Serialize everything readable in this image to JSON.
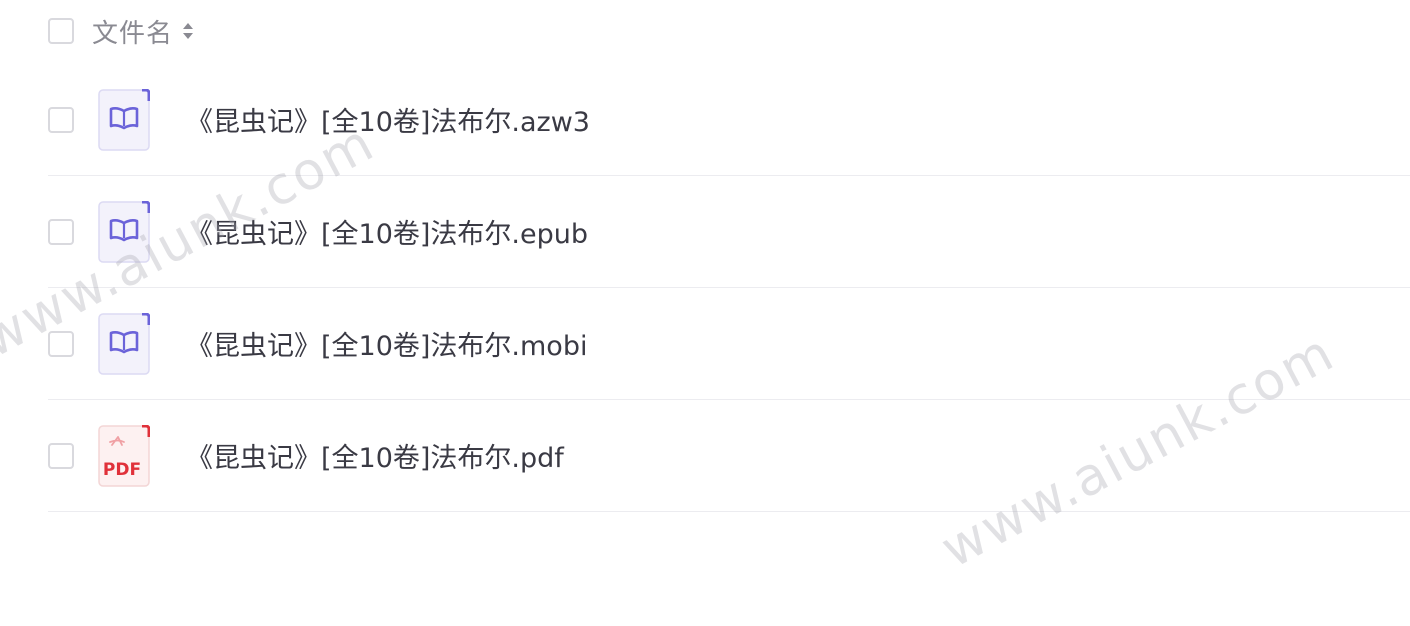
{
  "header": {
    "column_label": "文件名",
    "sort_icon": "sort-icon"
  },
  "files": [
    {
      "name": "《昆虫记》[全10卷]法布尔.azw3",
      "icon": "ebook-icon"
    },
    {
      "name": "《昆虫记》[全10卷]法布尔.epub",
      "icon": "ebook-icon"
    },
    {
      "name": "《昆虫记》[全10卷]法布尔.mobi",
      "icon": "ebook-icon"
    },
    {
      "name": "《昆虫记》[全10卷]法布尔.pdf",
      "icon": "pdf-icon",
      "icon_text": "PDF"
    }
  ],
  "watermark": "www.aiunk.com",
  "colors": {
    "ebook_accent": "#6b63d9",
    "ebook_bg": "#f3f2fb",
    "pdf_accent": "#e0313a",
    "pdf_bg": "#fdf1f1"
  }
}
